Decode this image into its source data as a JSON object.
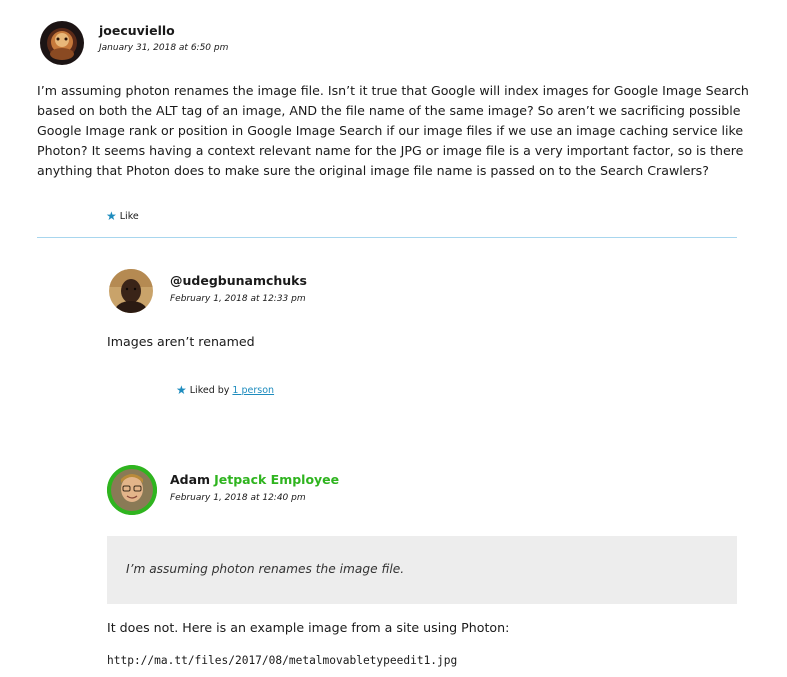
{
  "comments": [
    {
      "author": "joecuviello",
      "date": "January 31, 2018 at 6:50 pm",
      "body_lines": [
        "I’m assuming photon renames the image file. Isn’t it true that Google will index images for Google Image Search",
        "based on both the ALT tag of an image, AND the file name of the same image? So aren’t we sacrificing possible",
        "Google Image rank or position in Google Image Search if our image files if we use an image caching service like",
        "Photon? It seems having a context relevant name for the JPG or image file is a very important factor, so is there",
        "anything that Photon does to make sure the original image file name is passed on to the Search Crawlers?"
      ],
      "like_label": "Like"
    },
    {
      "author": "@udegbunamchuks",
      "date": "February 1, 2018 at 12:33 pm",
      "body": "Images aren’t renamed",
      "liked_by_prefix": "Liked by",
      "liked_by_link": "1 person"
    },
    {
      "author": "Adam",
      "badge": "Jetpack Employee",
      "date": "February 1, 2018 at 12:40 pm",
      "quote": "I’m assuming photon renames the image file.",
      "body": "It does not. Here is an example image from a site using Photon:",
      "code": "http://ma.tt/files/2017/08/metalmovabletypeedit1.jpg"
    }
  ],
  "icons": {
    "star": "star-icon"
  },
  "colors": {
    "accent_blue": "#1e8cbe",
    "employee_green": "#2fb41f",
    "divider": "#a8d6ee",
    "quote_bg": "#ededed"
  }
}
